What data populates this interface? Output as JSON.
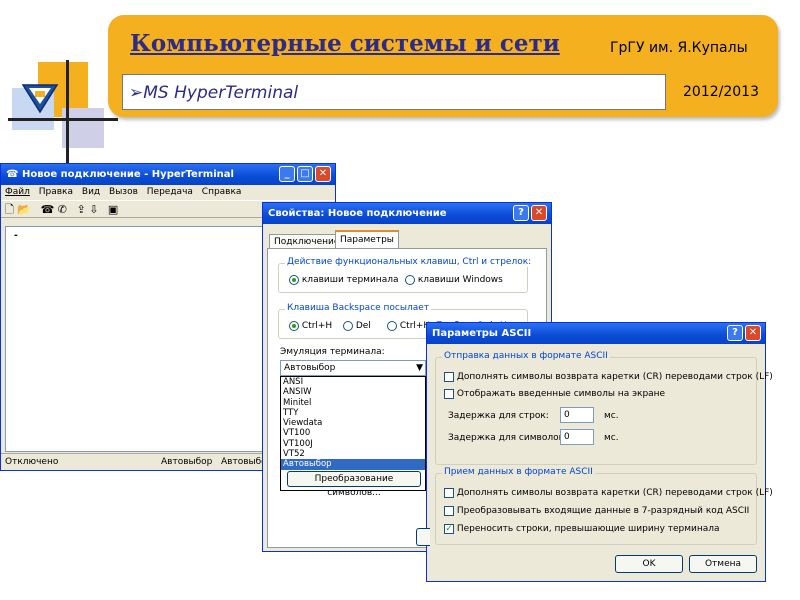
{
  "slide": {
    "title": "Компьютерные системы и сети",
    "university": "ГрГУ им. Я.Купалы",
    "subtitle": "MS HyperTerminal",
    "year": "2012/2013"
  },
  "hyperterminal": {
    "title": "Новое подключение - HyperTerminal",
    "menu": [
      "Файл",
      "Правка",
      "Вид",
      "Вызов",
      "Передача",
      "Справка"
    ],
    "cursor": "-",
    "status": [
      "Отключено",
      "Автовыбор",
      "Автовыбор"
    ]
  },
  "properties": {
    "title": "Свойства: Новое подключение",
    "tabs": [
      "Подключение",
      "Параметры"
    ],
    "fkeys_group": "Действие функциональных клавиш, Ctrl и стрелок:",
    "fkeys_options": [
      "клавиши терминала",
      "клавиши Windows"
    ],
    "backspace_group": "Клавиша Backspace посылает",
    "backspace_options": [
      "Ctrl+H",
      "Del",
      "Ctrl+H, Пробел, Ctrl+H"
    ],
    "emulation_label": "Эмуляция терминала:",
    "emulation_value": "Автовыбор",
    "emulation_options": [
      "ANSI",
      "ANSIW",
      "Minitel",
      "TTY",
      "Viewdata",
      "VT100",
      "VT100J",
      "VT52",
      "Автовыбор"
    ],
    "selected_option": "Автовыбор",
    "char_translation_button": "Преобразование символов..."
  },
  "ascii": {
    "title": "Параметры ASCII",
    "send_group": "Отправка данных в формате ASCII",
    "send_opt1": "Дополнять символы возврата каретки (CR) переводами строк (LF)",
    "send_opt2": "Отображать введенные символы на экране",
    "line_delay_label": "Задержка для строк:",
    "line_delay_value": "0",
    "char_delay_label": "Задержка для символов:",
    "char_delay_value": "0",
    "unit": "мс.",
    "recv_group": "Прием данных в формате ASCII",
    "recv_opt1": "Дополнять символы возврата каретки (CR) переводами строк (LF)",
    "recv_opt2": "Преобразовывать входящие данные в 7-разрядный код ASCII",
    "recv_opt3": "Переносить строки, превышающие ширину терминала",
    "recv_opt3_checked": true,
    "ok": "OK",
    "cancel": "Отмена"
  },
  "colors": {
    "banner": "#f4b01e",
    "title_text": "#2b2b8a",
    "titlebar": "#0a4cd6",
    "dialog_bg": "#ece9d8",
    "selection": "#316ac5"
  }
}
